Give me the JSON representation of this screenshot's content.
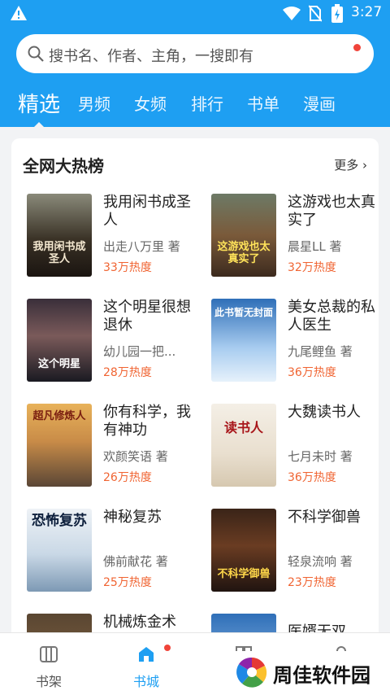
{
  "status": {
    "time": "3:27"
  },
  "search": {
    "placeholder": "搜书名、作者、主角，一搜即有"
  },
  "tabs": [
    "精选",
    "男频",
    "女频",
    "排行",
    "书单",
    "漫画"
  ],
  "section": {
    "title": "全网大热榜",
    "more": "更多"
  },
  "books": [
    {
      "title": "我用闲书成圣人",
      "author": "出走八万里 著",
      "heat": "33万热度",
      "cover_text": "我用闲书成圣人"
    },
    {
      "title": "这游戏也太真实了",
      "author": "晨星LL 著",
      "heat": "32万热度",
      "cover_text": "这游戏也太真实了"
    },
    {
      "title": "这个明星很想退休",
      "author": "幼儿园一把...",
      "heat": "28万热度",
      "cover_text": "这个明星"
    },
    {
      "title": "美女总裁的私人医生",
      "author": "九尾鲤鱼 著",
      "heat": "36万热度",
      "cover_text": "此书暂无封面"
    },
    {
      "title": "你有科学，我有神功",
      "author": "欢颜笑语 著",
      "heat": "26万热度",
      "cover_text": "超凡修炼人"
    },
    {
      "title": "大魏读书人",
      "author": "七月未时 著",
      "heat": "36万热度",
      "cover_text": "读书人"
    },
    {
      "title": "神秘复苏",
      "author": "佛前献花 著",
      "heat": "25万热度",
      "cover_text": "恐怖复苏"
    },
    {
      "title": "不科学御兽",
      "author": "轻泉流响 著",
      "heat": "23万热度",
      "cover_text": "不科学御兽"
    },
    {
      "title": "机械炼金术",
      "author": "",
      "heat": "",
      "cover_text": ""
    },
    {
      "title": "医婿无双",
      "author": "",
      "heat": "",
      "cover_text": ""
    }
  ],
  "nav": [
    {
      "label": "书架",
      "icon": "bookshelf-icon"
    },
    {
      "label": "书城",
      "icon": "store-icon"
    },
    {
      "label": "",
      "icon": "category-icon"
    },
    {
      "label": "",
      "icon": "profile-icon"
    }
  ],
  "watermark": {
    "text": "周佳软件园"
  },
  "colors": {
    "brand": "#1e9ff2",
    "heat": "#f06432",
    "dot": "#f0443a"
  }
}
